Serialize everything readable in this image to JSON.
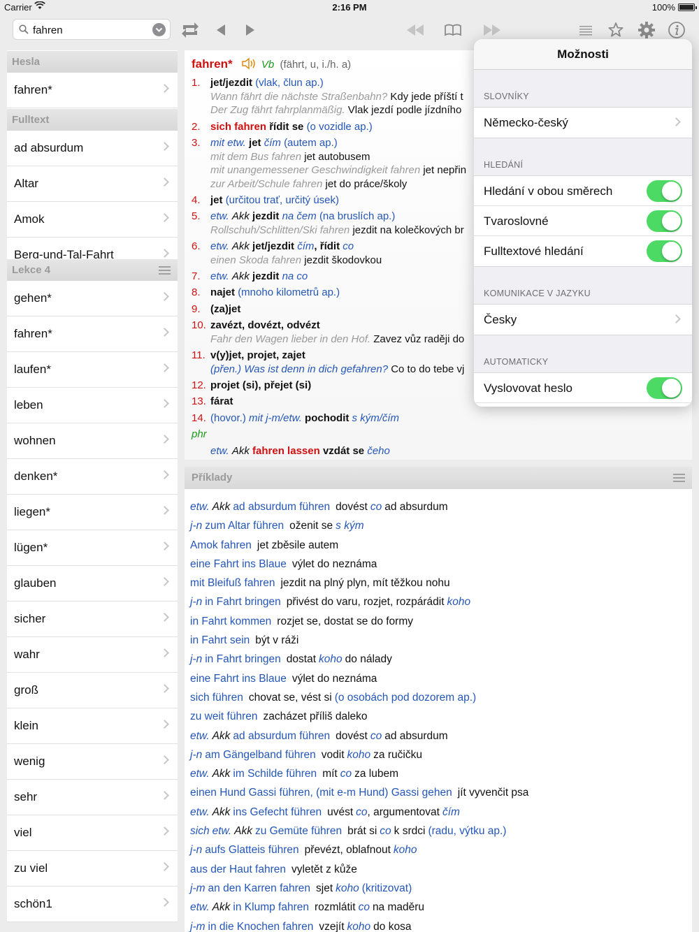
{
  "status": {
    "carrier": "Carrier",
    "time": "2:16 PM",
    "battery": "100%"
  },
  "search": {
    "value": "fahren"
  },
  "sections": {
    "hesla": {
      "title": "Hesla",
      "items": [
        "fahren*"
      ]
    },
    "fulltext": {
      "title": "Fulltext",
      "items": [
        "ad absurdum",
        "Altar",
        "Amok",
        "Berg-und-Tal-Fahrt"
      ]
    },
    "lekce": {
      "title": "Lekce 4",
      "items": [
        "gehen*",
        "fahren*",
        "laufen*",
        "leben",
        "wohnen",
        "denken*",
        "liegen*",
        "lügen*",
        "glauben",
        "sicher",
        "wahr",
        "groß",
        "klein",
        "wenig",
        "sehr",
        "viel",
        "zu viel",
        "schön1"
      ]
    }
  },
  "entry": {
    "headword": "fahren*",
    "pos": "Vb",
    "forms": "(fährt, u, i./h. a)",
    "s1": {
      "num": "1.",
      "tr": "jet/jezdit",
      "note": "(vlak, člun ap.)"
    },
    "s1e1": {
      "de": "Wann fährt die nächste Straßenbahn?",
      "cz": "Kdy jede příští t"
    },
    "s1e2": {
      "de": "Der Zug fährt fahrplanmäßig.",
      "cz": "Vlak jezdí podle jízdního"
    },
    "s2": {
      "num": "2.",
      "red": "sich fahren",
      "tr": "řídit se",
      "note": "(o vozidle ap.)"
    },
    "s3": {
      "num": "3.",
      "g1": "mit etw.",
      "tr": "jet",
      "g2": "čím",
      "note": "(autem ap.)"
    },
    "s3e1": {
      "de": "mit dem Bus fahren",
      "cz": "jet autobusem"
    },
    "s3e2": {
      "de": "mit unangemessener Geschwindigkeit fahren",
      "cz": "jet nepřin"
    },
    "s3e3": {
      "de": "zur Arbeit/Schule fahren",
      "cz": "jet do práce/školy"
    },
    "s4": {
      "num": "4.",
      "tr": "jet",
      "note": "(určitou trať, určitý úsek)"
    },
    "s5": {
      "num": "5.",
      "g1": "etw.",
      "akk": "Akk",
      "tr": "jezdit",
      "g2": "na čem",
      "note": "(na bruslích ap.)"
    },
    "s5e1": {
      "de": "Rollschuh/Schlitten/Ski fahren",
      "cz": "jezdit na kolečkových br"
    },
    "s6": {
      "num": "6.",
      "g1": "etw.",
      "akk": "Akk",
      "tr": "jet/jezdit",
      "g2": "čím",
      "tr2": ", řídit",
      "g3": "co"
    },
    "s6e1": {
      "de": "einen Skoda fahren",
      "cz": "jezdit škodovkou"
    },
    "s7": {
      "num": "7.",
      "g1": "etw.",
      "akk": "Akk",
      "tr": "jezdit",
      "g2": "na co"
    },
    "s8": {
      "num": "8.",
      "tr": "najet",
      "note": "(mnoho kilometrů ap.)"
    },
    "s9": {
      "num": "9.",
      "tr": "(za)jet"
    },
    "s10": {
      "num": "10.",
      "tr": "zavézt, dovézt, odvézt"
    },
    "s10e1": {
      "de": "Fahr den Wagen lieber in den Hof.",
      "cz": "Zavez vůz raději do"
    },
    "s11": {
      "num": "11.",
      "tr": "v(y)jet, projet, zajet"
    },
    "s11e1": {
      "pren": "(přen.)",
      "de": "Was ist denn in dich gefahren?",
      "cz": "Co to do tebe vj"
    },
    "s12": {
      "num": "12.",
      "tr": "projet (si), přejet (si)"
    },
    "s13": {
      "num": "13.",
      "tr": "fárat"
    },
    "s14": {
      "num": "14.",
      "note": "(hovor.)",
      "g1": "mit j-m/etw.",
      "tr": "pochodit",
      "g2": "s kým/čím"
    },
    "phr": "phr",
    "phr1": {
      "g1": "etw.",
      "akk": "Akk",
      "red": "fahren lassen",
      "tr": "vzdát se",
      "g2": "čeho"
    }
  },
  "examples": {
    "title": "Příklady",
    "rows": [
      {
        "g": "etw.",
        "a": "Akk",
        "de": "ad absurdum führen",
        "cz": "dovést",
        "cg": "co",
        "cz2": "ad absurdum"
      },
      {
        "g": "j-n",
        "de": "zum Altar führen",
        "cz": "oženit se",
        "cg": "s kým"
      },
      {
        "de": "Amok fahren",
        "cz": "jet zběsile autem"
      },
      {
        "de": "eine Fahrt ins Blaue",
        "cz": "výlet do neznáma"
      },
      {
        "de": "mit Bleifuß fahren",
        "cz": "jezdit na plný plyn, mít těžkou nohu"
      },
      {
        "g": "j-n",
        "de": "in Fahrt bringen",
        "cz": "přivést do varu, rozjet, rozpárádit",
        "cg": "koho"
      },
      {
        "de": "in Fahrt kommen",
        "cz": "rozjet se, dostat se do formy"
      },
      {
        "de": "in Fahrt sein",
        "cz": "být v ráži"
      },
      {
        "g": "j-n",
        "de": "in Fahrt bringen",
        "cz": "dostat",
        "cg": "koho",
        "cz2": "do nálady"
      },
      {
        "de": "eine Fahrt ins Blaue",
        "cz": "výlet do neznáma"
      },
      {
        "de": "sich führen",
        "cz": "chovat se, vést si",
        "cn": "(o osobách pod dozorem ap.)"
      },
      {
        "de": "zu weit führen",
        "cz": "zacházet příliš daleko"
      },
      {
        "g": "etw.",
        "a": "Akk",
        "de": "ad absurdum führen",
        "cz": "dovést",
        "cg": "co",
        "cz2": "ad absurdum"
      },
      {
        "g": "j-n",
        "de": "am Gängelband führen",
        "cz": "vodit",
        "cg": "koho",
        "cz2": "za ručičku"
      },
      {
        "g": "etw.",
        "a": "Akk",
        "de": "im Schilde führen",
        "cz": "mít",
        "cg": "co",
        "cz2": "za lubem"
      },
      {
        "de": "einen Hund Gassi führen, (mit e-m Hund) Gassi gehen",
        "cz": "jít vyvenčit psa"
      },
      {
        "g": "etw.",
        "a": "Akk",
        "de": "ins Gefecht führen",
        "cz": "uvést",
        "cg": "co",
        "cz2": ", argumentovat",
        "cg2": "čím"
      },
      {
        "pre": "sich",
        "g": "etw.",
        "a": "Akk",
        "de": "zu Gemüte führen",
        "cz": "brát si",
        "cg": "co",
        "cz2": "k srdci",
        "cn": "(radu, výtku ap.)"
      },
      {
        "g": "j-n",
        "de": "aufs Glatteis führen",
        "cz": "převézt, oblafnout",
        "cg": "koho"
      },
      {
        "de": "aus der Haut fahren",
        "cz": "vyletět z kůže"
      },
      {
        "g": "j-m",
        "de": "an den Karren fahren",
        "cz": "sjet",
        "cg": "koho",
        "cn": "(kritizovat)"
      },
      {
        "g": "etw.",
        "a": "Akk",
        "de": "in Klump fahren",
        "cz": "rozmlátit",
        "cg": "co",
        "cz2": "na maděru"
      },
      {
        "g": "j-m",
        "de": "in die Knochen fahren",
        "cz": "vzejít",
        "cg": "koho",
        "cz2": "do kosa"
      }
    ]
  },
  "popover": {
    "title": "Možnosti",
    "sec1": "SLOVNÍKY",
    "dict": "Německo-český",
    "sec2": "HLEDÁNÍ",
    "opt1": "Hledání v obou směrech",
    "opt2": "Tvaroslovné",
    "opt3": "Fulltextové hledání",
    "sec3": "KOMUNIKACE V JAZYKU",
    "lang": "Česky",
    "sec4": "AUTOMATICKY",
    "opt4": "Vyslovovat heslo"
  },
  "colors": {
    "toggle_on": "#4cd964",
    "headword_red": "#d01010",
    "link_blue": "#2456b8",
    "pos_green": "#1a9a1a"
  }
}
